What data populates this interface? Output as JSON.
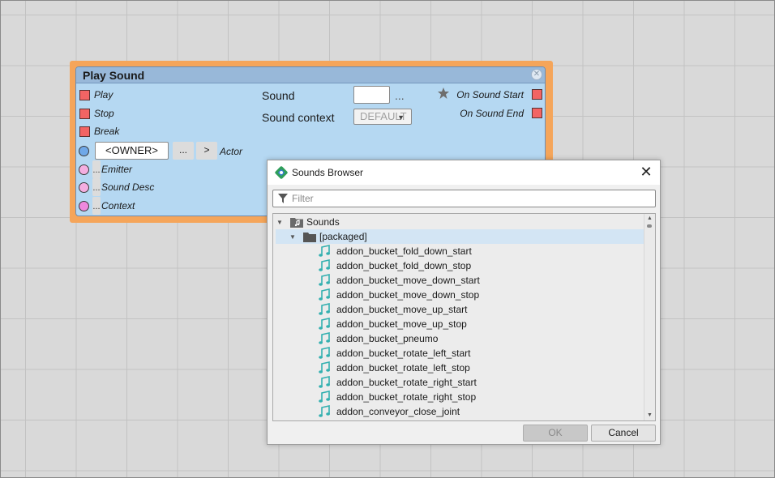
{
  "node": {
    "title": "Play Sound",
    "inputs": [
      {
        "label": "Play",
        "pin": "square"
      },
      {
        "label": "Stop",
        "pin": "square"
      },
      {
        "label": "Break",
        "pin": "square"
      }
    ],
    "actor": {
      "value": "<OWNER>",
      "browse": "...",
      "goto": ">",
      "label": "Actor"
    },
    "extra_inputs": [
      {
        "dots": "...",
        "label": "Emitter"
      },
      {
        "dots": "...",
        "label": "Sound Desc"
      },
      {
        "dots": "...",
        "label": "Context"
      }
    ],
    "properties": {
      "sound_label": "Sound",
      "sound_value": "",
      "sound_browse": "...",
      "context_label": "Sound context",
      "context_value": "DEFAULT"
    },
    "outputs": [
      {
        "label": "On Sound Start"
      },
      {
        "label": "On Sound End"
      }
    ],
    "colors": {
      "outline": "#f5a55a",
      "body": "#b5d8f2",
      "title_bar": "#98b8d9",
      "pin_square": "#f26464",
      "pin_actor": "#6fa8e8",
      "pin_pink": "#f4aee0",
      "pin_magenta": "#ee88dd"
    }
  },
  "dialog": {
    "title": "Sounds Browser",
    "filter_placeholder": "Filter",
    "tree": {
      "root": "Sounds",
      "folder": "[packaged]",
      "items": [
        "addon_bucket_fold_down_start",
        "addon_bucket_fold_down_stop",
        "addon_bucket_move_down_start",
        "addon_bucket_move_down_stop",
        "addon_bucket_move_up_start",
        "addon_bucket_move_up_stop",
        "addon_bucket_pneumo",
        "addon_bucket_rotate_left_start",
        "addon_bucket_rotate_left_stop",
        "addon_bucket_rotate_right_start",
        "addon_bucket_rotate_right_stop",
        "addon_conveyor_close_joint"
      ]
    },
    "buttons": {
      "ok": "OK",
      "cancel": "Cancel"
    },
    "colors": {
      "music_icon": "#33b0b0",
      "selection": "#d3e5f4"
    }
  }
}
